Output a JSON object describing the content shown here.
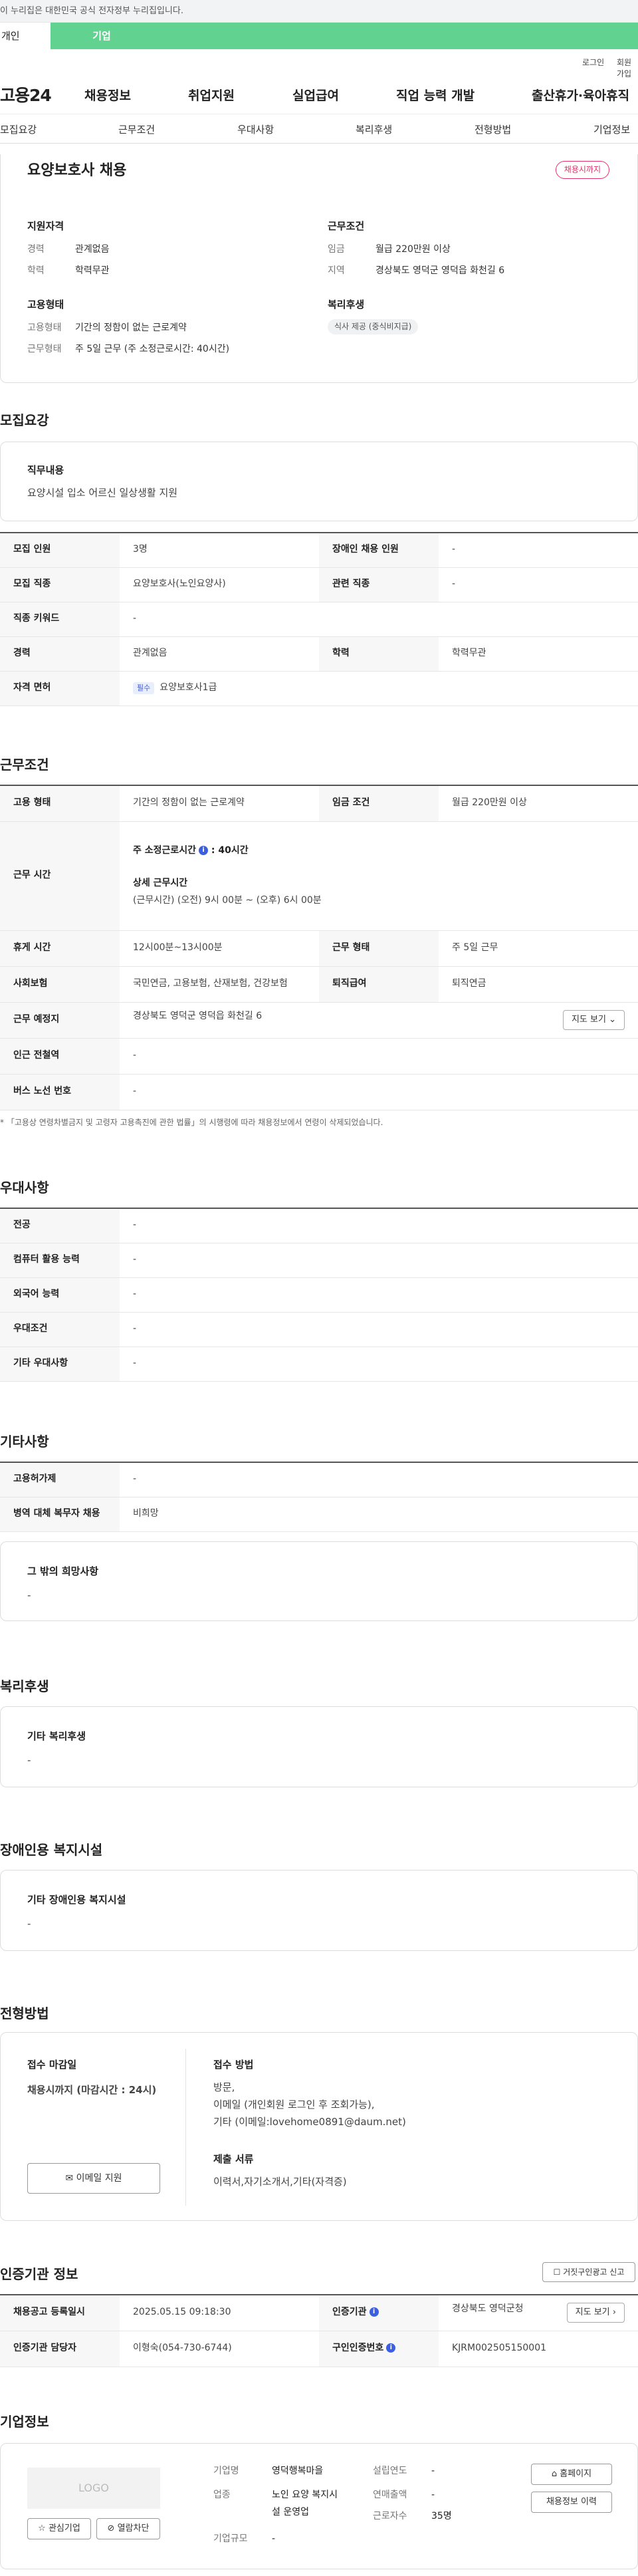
{
  "gov_banner": "이 누리집은 대한민국 공식 전자정부 누리집입니다.",
  "tabs": {
    "personal": "개인",
    "company": "기업"
  },
  "util": {
    "login": "로그인",
    "join": "회원가입"
  },
  "logo": "고용24",
  "gnb": [
    "채용정보",
    "취업지원",
    "실업급여",
    "직업 능력 개발",
    "출산휴가·육아휴직"
  ],
  "subnav": [
    "모집요강",
    "근무조건",
    "우대사항",
    "복리후생",
    "전형방법",
    "기업정보"
  ],
  "summary": {
    "title": "요양보호사 채용",
    "deadline_badge": "채용시까지",
    "qual_head": "지원자격",
    "qual": [
      {
        "k": "경력",
        "v": "관계없음"
      },
      {
        "k": "학력",
        "v": "학력무관"
      }
    ],
    "cond_head": "근무조건",
    "cond": [
      {
        "k": "임금",
        "v": "월급 220만원 이상"
      },
      {
        "k": "지역",
        "v": "경상북도 영덕군 영덕읍 화천길 6"
      }
    ],
    "emp_head": "고용형태",
    "emp": [
      {
        "k": "고용형태",
        "v": "기간의 정함이 없는 근로계약"
      },
      {
        "k": "근무형태",
        "v": "주 5일 근무 (주 소정근로시간: 40시간)"
      }
    ],
    "welfare_head": "복리후생",
    "welfare_chip": "식사 제공 (중식비지급)"
  },
  "recruit": {
    "heading": "모집요강",
    "duty_title": "직무내용",
    "duty_text": "요양시설 입소 어르신 일상생활 지원",
    "rows": [
      {
        "l1": "모집 인원",
        "v1": "3명",
        "l2": "장애인 채용 인원",
        "v2": "-"
      },
      {
        "l1": "모집 직종",
        "v1": "요양보호사(노인요양사)",
        "l2": "관련 직종",
        "v2": "-"
      },
      {
        "l1": "직종 키워드",
        "v1": "-"
      },
      {
        "l1": "경력",
        "v1": "관계없음",
        "l2": "학력",
        "v2": "학력무관"
      },
      {
        "l1": "자격 면허",
        "v1_tag": "필수",
        "v1": "요양보호사1급"
      }
    ]
  },
  "work": {
    "heading": "근무조건",
    "emp_type_l": "고용 형태",
    "emp_type_v": "기간의 정함이 없는 근로계약",
    "wage_l": "임금 조건",
    "wage_v": "월급 220만원 이상",
    "hours_l": "근무 시간",
    "hours_main": "주 소정근로시간",
    "hours_value": ": 40시간",
    "hours_detail_title": "상세 근무시간",
    "hours_detail": "(근무시간) (오전) 9시 00분 ~ (오후) 6시 00분",
    "break_l": "휴게 시간",
    "break_v": "12시00분~13시00분",
    "form_l": "근무 형태",
    "form_v": "주 5일 근무",
    "ins_l": "사회보험",
    "ins_v": "국민연금, 고용보험, 산재보험, 건강보험",
    "retire_l": "퇴직급여",
    "retire_v": "퇴직연금",
    "place_l": "근무 예정지",
    "place_v": "경상북도 영덕군 영덕읍 화천길 6",
    "map_btn": "지도 보기",
    "subway_l": "인근 전철역",
    "subway_v": "-",
    "bus_l": "버스 노선 번호",
    "bus_v": "-",
    "footnote": "* 「고용상 연령차별금지 및 고령자 고용촉진에 관한 법률」의 시행령에 따라 채용정보에서 연령이 삭제되었습니다."
  },
  "pref": {
    "heading": "우대사항",
    "rows": [
      {
        "l": "전공",
        "v": "-"
      },
      {
        "l": "컴퓨터 활용 능력",
        "v": "-"
      },
      {
        "l": "외국어 능력",
        "v": "-"
      },
      {
        "l": "우대조건",
        "v": "-"
      },
      {
        "l": "기타 우대사항",
        "v": "-"
      }
    ]
  },
  "etc": {
    "heading": "기타사항",
    "rows": [
      {
        "l": "고용허가제",
        "v": "-"
      },
      {
        "l": "병역 대체 복무자 채용",
        "v": "비희망"
      }
    ],
    "other_title": "그 밖의 희망사항",
    "other_val": "-"
  },
  "welfare": {
    "heading": "복리후생",
    "title": "기타 복리후생",
    "val": "-"
  },
  "disabled": {
    "heading": "장애인용 복지시설",
    "title": "기타 장애인용 복지시설",
    "val": "-"
  },
  "selection": {
    "heading": "전형방법",
    "deadline_title": "접수 마감일",
    "deadline_val": "채용시까지 (마감시간 : 24시)",
    "email_btn": "이메일 지원",
    "method_title": "접수 방법",
    "method_lines": [
      "방문,",
      "이메일 (개인회원 로그인 후 조회가능),",
      "기타 (이메일:lovehome0891@daum.net)"
    ],
    "docs_title": "제출 서류",
    "docs_val": "이력서,자기소개서,기타(자격증)"
  },
  "agency": {
    "heading": "인증기관 정보",
    "report_btn": "거짓구인광고 신고",
    "reg_l": "채용공고 등록일시",
    "reg_v": "2025.05.15 09:18:30",
    "agency_l": "인증기관",
    "agency_v": "경상북도 영덕군청",
    "map_btn": "지도 보기",
    "manager_l": "인증기관 담당자",
    "manager_v": "이형숙(054-730-6744)",
    "cert_l": "구인인증번호",
    "cert_v": "KJRM002505150001"
  },
  "company": {
    "heading": "기업정보",
    "logo": "LOGO",
    "fav_btn": "관심기업",
    "block_btn": "열람차단",
    "name_l": "기업명",
    "name_v": "영덕행복마을",
    "biz_l": "업종",
    "biz_v": [
      "노인 요양 복지시",
      "설 운영업"
    ],
    "scale_l": "기업규모",
    "scale_v": "-",
    "year_l": "설립연도",
    "year_v": "-",
    "sales_l": "연매출액",
    "sales_v": "-",
    "emp_l": "근로자수",
    "emp_v": "35명",
    "home_btn": "홈페이지",
    "history_btn": "채용정보 이력"
  }
}
